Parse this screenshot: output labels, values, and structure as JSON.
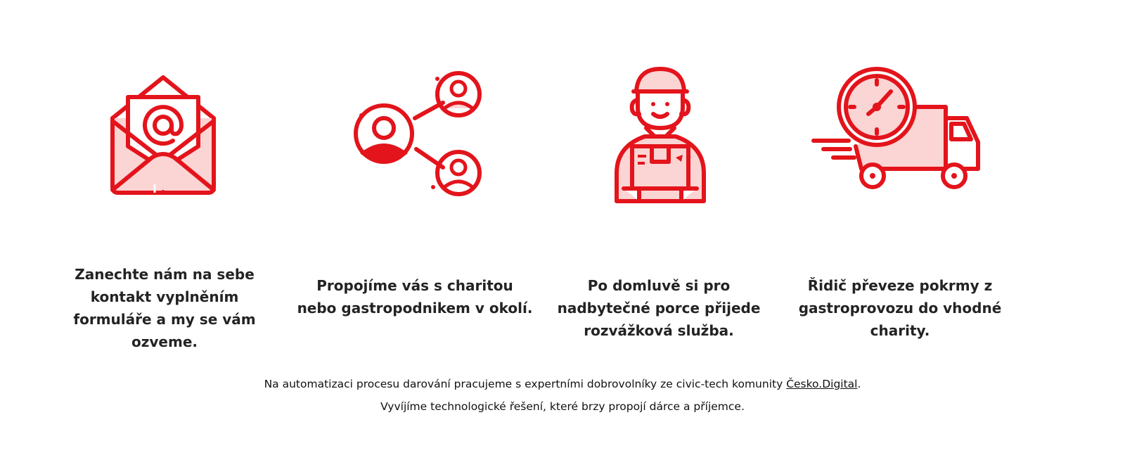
{
  "colors": {
    "accent": "#e3141b",
    "accent_light": "#fbd4d4",
    "text": "#232323"
  },
  "steps": [
    {
      "icon": "envelope-email-icon",
      "text": "Zanechte nám na sebe kontakt vyplněním formuláře a my se vám ozveme."
    },
    {
      "icon": "share-network-icon",
      "text": "Propojíme vás s charitou nebo gastropodnikem v okolí."
    },
    {
      "icon": "delivery-courier-icon",
      "text": "Po domluvě si pro nadbytečné porce přijede rozvážková služba."
    },
    {
      "icon": "fast-delivery-truck-icon",
      "text": "Řidič převeze pokrmy z gastroprovozu do vhodné charity."
    }
  ],
  "footer": {
    "line1_before": "Na automatizaci procesu darování pracujeme s expertními dobrovolníky ze civic-tech komunity ",
    "link_label": "Česko.Digital",
    "line1_after": ".",
    "line2": "Vyvíjíme technologické řešení, které brzy propojí dárce a příjemce."
  }
}
